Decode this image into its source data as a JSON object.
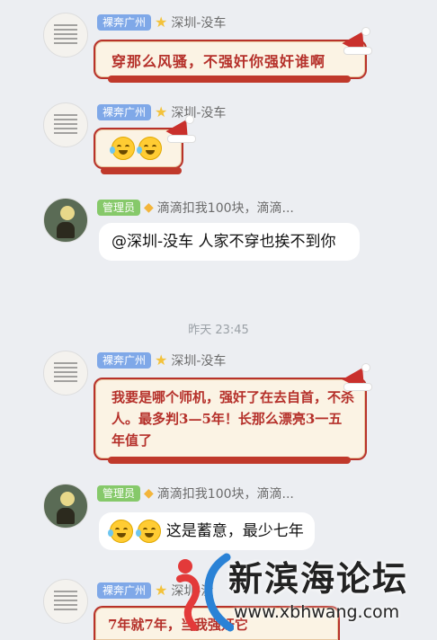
{
  "messages": [
    {
      "badge": "裸奔广州",
      "name": "深圳-没车",
      "text": "穿那么风骚，不强奸你强奸谁啊"
    },
    {
      "badge": "裸奔广州",
      "name": "深圳-没车"
    },
    {
      "badge": "管理员",
      "name": "滴滴扣我100块，滴滴...",
      "text": "@深圳-没车 人家不穿也挨不到你"
    },
    {
      "badge": "裸奔广州",
      "name": "深圳-没车",
      "text": "我要是哪个师机，强奸了在去自首，不杀人。最多判3—5年！长那么漂亮3一五年值了"
    },
    {
      "badge": "管理员",
      "name": "滴滴扣我100块，滴滴...",
      "text": "这是蓄意，最少七年"
    },
    {
      "badge": "裸奔广州",
      "name": "深圳-没",
      "text": "7年就7年，当我强奸它"
    }
  ],
  "timestamp": "昨天 23:45",
  "watermark": {
    "title": "新滨海论坛",
    "url": "www.xbhwang.com"
  },
  "colors": {
    "card_border": "#b8322a",
    "card_text": "#b5302a",
    "badge_blue": "#7fa8e8",
    "badge_green": "#86c96a"
  }
}
